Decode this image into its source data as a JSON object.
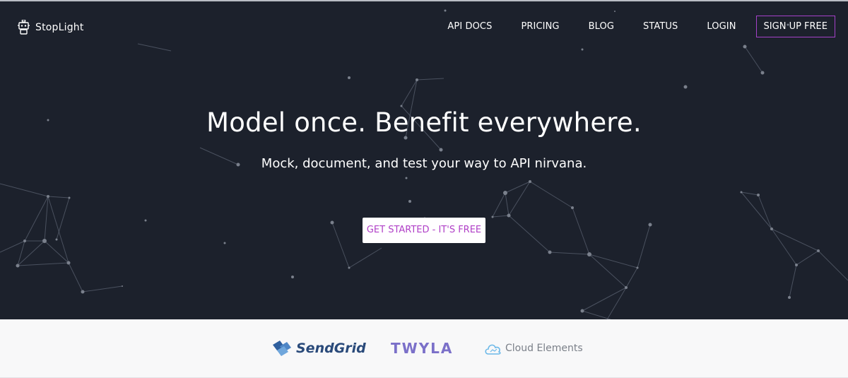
{
  "brand": {
    "name": "StopLight"
  },
  "nav": {
    "links": [
      "API DOCS",
      "PRICING",
      "BLOG",
      "STATUS",
      "LOGIN"
    ],
    "signup_label": "SIGN UP FREE"
  },
  "hero": {
    "headline": "Model once. Benefit everywhere.",
    "subheadline": "Mock, document, and test your way to API nirvana.",
    "cta_label": "GET STARTED - IT'S FREE"
  },
  "partners": {
    "sendgrid": "SendGrid",
    "twyla": "TWYLA",
    "cloud_elements": "Cloud Elements"
  },
  "colors": {
    "hero_bg": "#1c212c",
    "accent": "#a541c9",
    "cta_text": "#b03fc7"
  }
}
